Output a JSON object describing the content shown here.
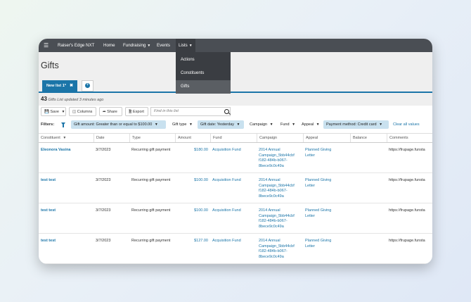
{
  "nav": {
    "app_name": "Raiser's Edge NXT",
    "items": [
      "Home",
      "Fundraising",
      "Events",
      "Lists"
    ]
  },
  "lists_menu": [
    "Actions",
    "Constituents",
    "Gifts"
  ],
  "page": {
    "title": "Gifts",
    "tab_label": "New list 1*",
    "count": "43",
    "updated": "Gifts List updated 3 minutes ago"
  },
  "toolbar": {
    "save": "Save",
    "columns": "Columns",
    "share": "Share",
    "export": "Export",
    "search_placeholder": "Find in this list"
  },
  "filters": {
    "label": "Filters:",
    "chips": [
      "Gift amount: Greater than or equal to $100.00",
      "Gift type",
      "Gift date: Yesterday",
      "Campaign",
      "Fund",
      "Appeal",
      "Payment method: Credit card"
    ],
    "clear": "Clear all values"
  },
  "table": {
    "columns": [
      "Constituent",
      "Date",
      "Type",
      "Amount",
      "Fund",
      "Campaign",
      "Appeal",
      "Balance",
      "Comments"
    ],
    "rows": [
      {
        "constituent": "Eleonora Vasina",
        "date": "3/7/2023",
        "type": "Recurring gift payment",
        "amount": "$180.00",
        "fund": "Acquisition Fund",
        "campaign": "2014 Annual Campaign_5bb44cbf f182-484b-b067-8bece9c0c49a",
        "appeal": "Planned Giving Letter",
        "balance": "",
        "comments": "https://frupage.funsta"
      },
      {
        "constituent": "test test",
        "date": "3/7/2023",
        "type": "Recurring gift payment",
        "amount": "$100.00",
        "fund": "Acquisition Fund",
        "campaign": "2014 Annual Campaign_5bb44cbf f182-484b-b067-8bece9c0c49a",
        "appeal": "Planned Giving Letter",
        "balance": "",
        "comments": "https://frupage.funsta"
      },
      {
        "constituent": "test test",
        "date": "3/7/2023",
        "type": "Recurring gift payment",
        "amount": "$100.00",
        "fund": "Acquisition Fund",
        "campaign": "2014 Annual Campaign_5bb44cbf f182-484b-b067-8bece9c0c49a",
        "appeal": "Planned Giving Letter",
        "balance": "",
        "comments": "https://frupage.funsta"
      },
      {
        "constituent": "test test",
        "date": "3/7/2023",
        "type": "Recurring gift payment",
        "amount": "$127.00",
        "fund": "Acquisition Fund",
        "campaign": "2014 Annual Campaign_5bb44cbf f182-484b-b067-8bece9c0c49a",
        "appeal": "Planned Giving Letter",
        "balance": "",
        "comments": "https://frupage.funsta"
      }
    ]
  }
}
